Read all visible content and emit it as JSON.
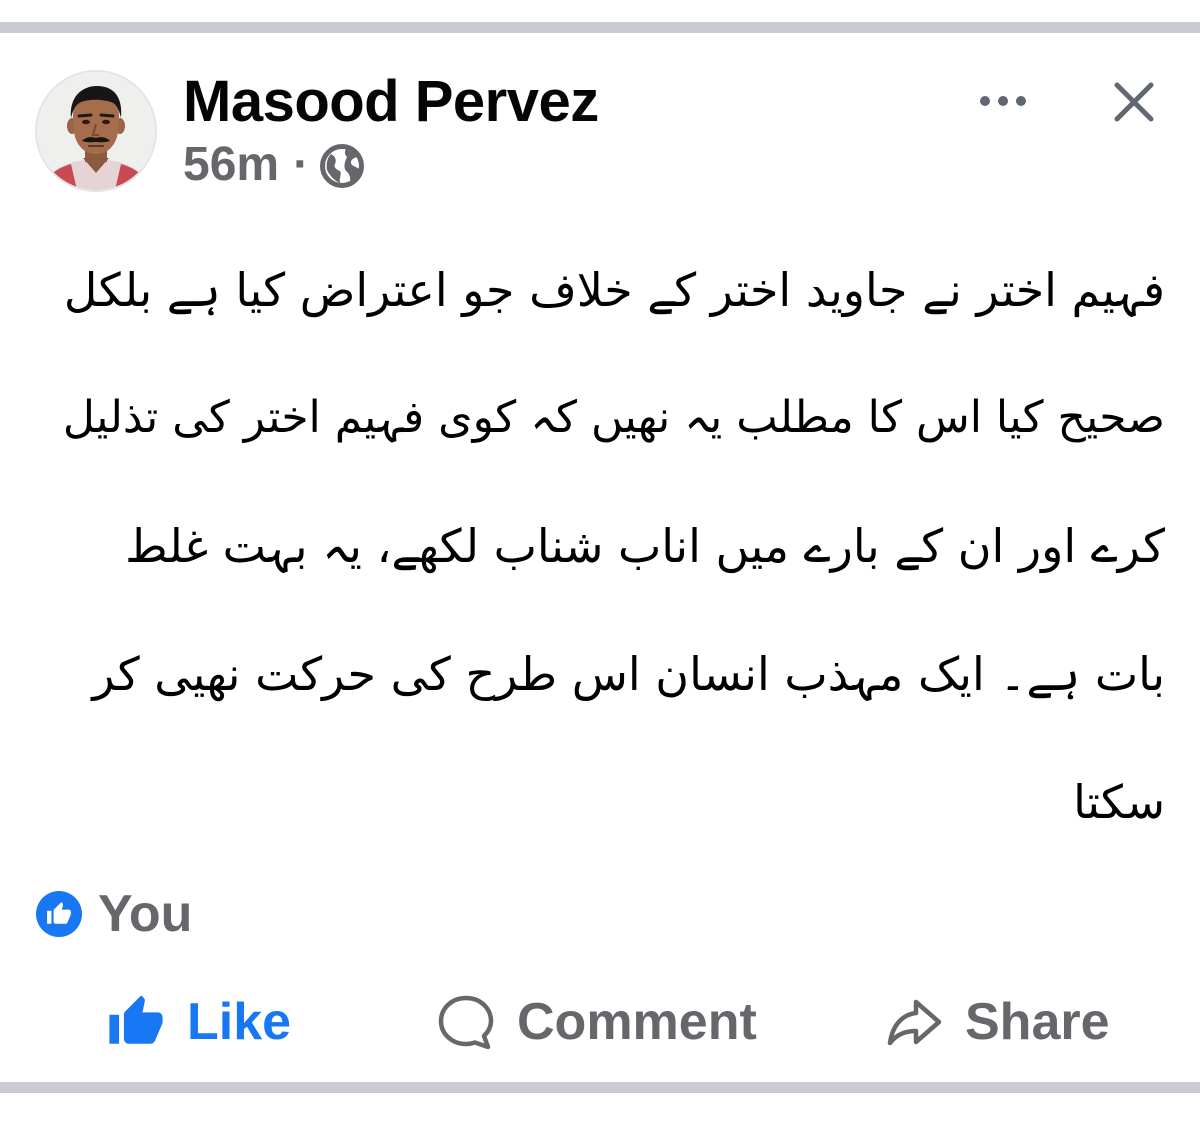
{
  "colors": {
    "accent": "#1877f2",
    "text": "#050505",
    "secondary": "#65676b",
    "icon": "#606770",
    "divider": "#c9ccd1"
  },
  "post": {
    "header": {
      "author_name": "Masood Pervez",
      "timestamp": "56m",
      "separator": "·",
      "audience_icon": "globe-icon",
      "more_icon": "more-options-icon",
      "close_icon": "close-icon"
    },
    "body": {
      "lines": [
        "فہیم اختر نے جاوید اختر کے خلاف جو اعتراض کیا ہے بلکل",
        "صحیح کیا اس کا مطلب یہ نھیں کہ کوی فہیم اختر کی تذلیل",
        "کرے اور ان کے بارے میں اناب شناب لکھے، یہ بہت غلط",
        "بات ہے۔ ایک مہذب انسان اس طرح کی حرکت نھیی کر",
        "سکتا"
      ]
    },
    "reactions": {
      "icon": "like-reaction-icon",
      "summary": "You"
    },
    "actions": {
      "like": {
        "label": "Like",
        "icon": "thumbs-up-icon"
      },
      "comment": {
        "label": "Comment",
        "icon": "comment-icon"
      },
      "share": {
        "label": "Share",
        "icon": "share-icon"
      }
    }
  }
}
